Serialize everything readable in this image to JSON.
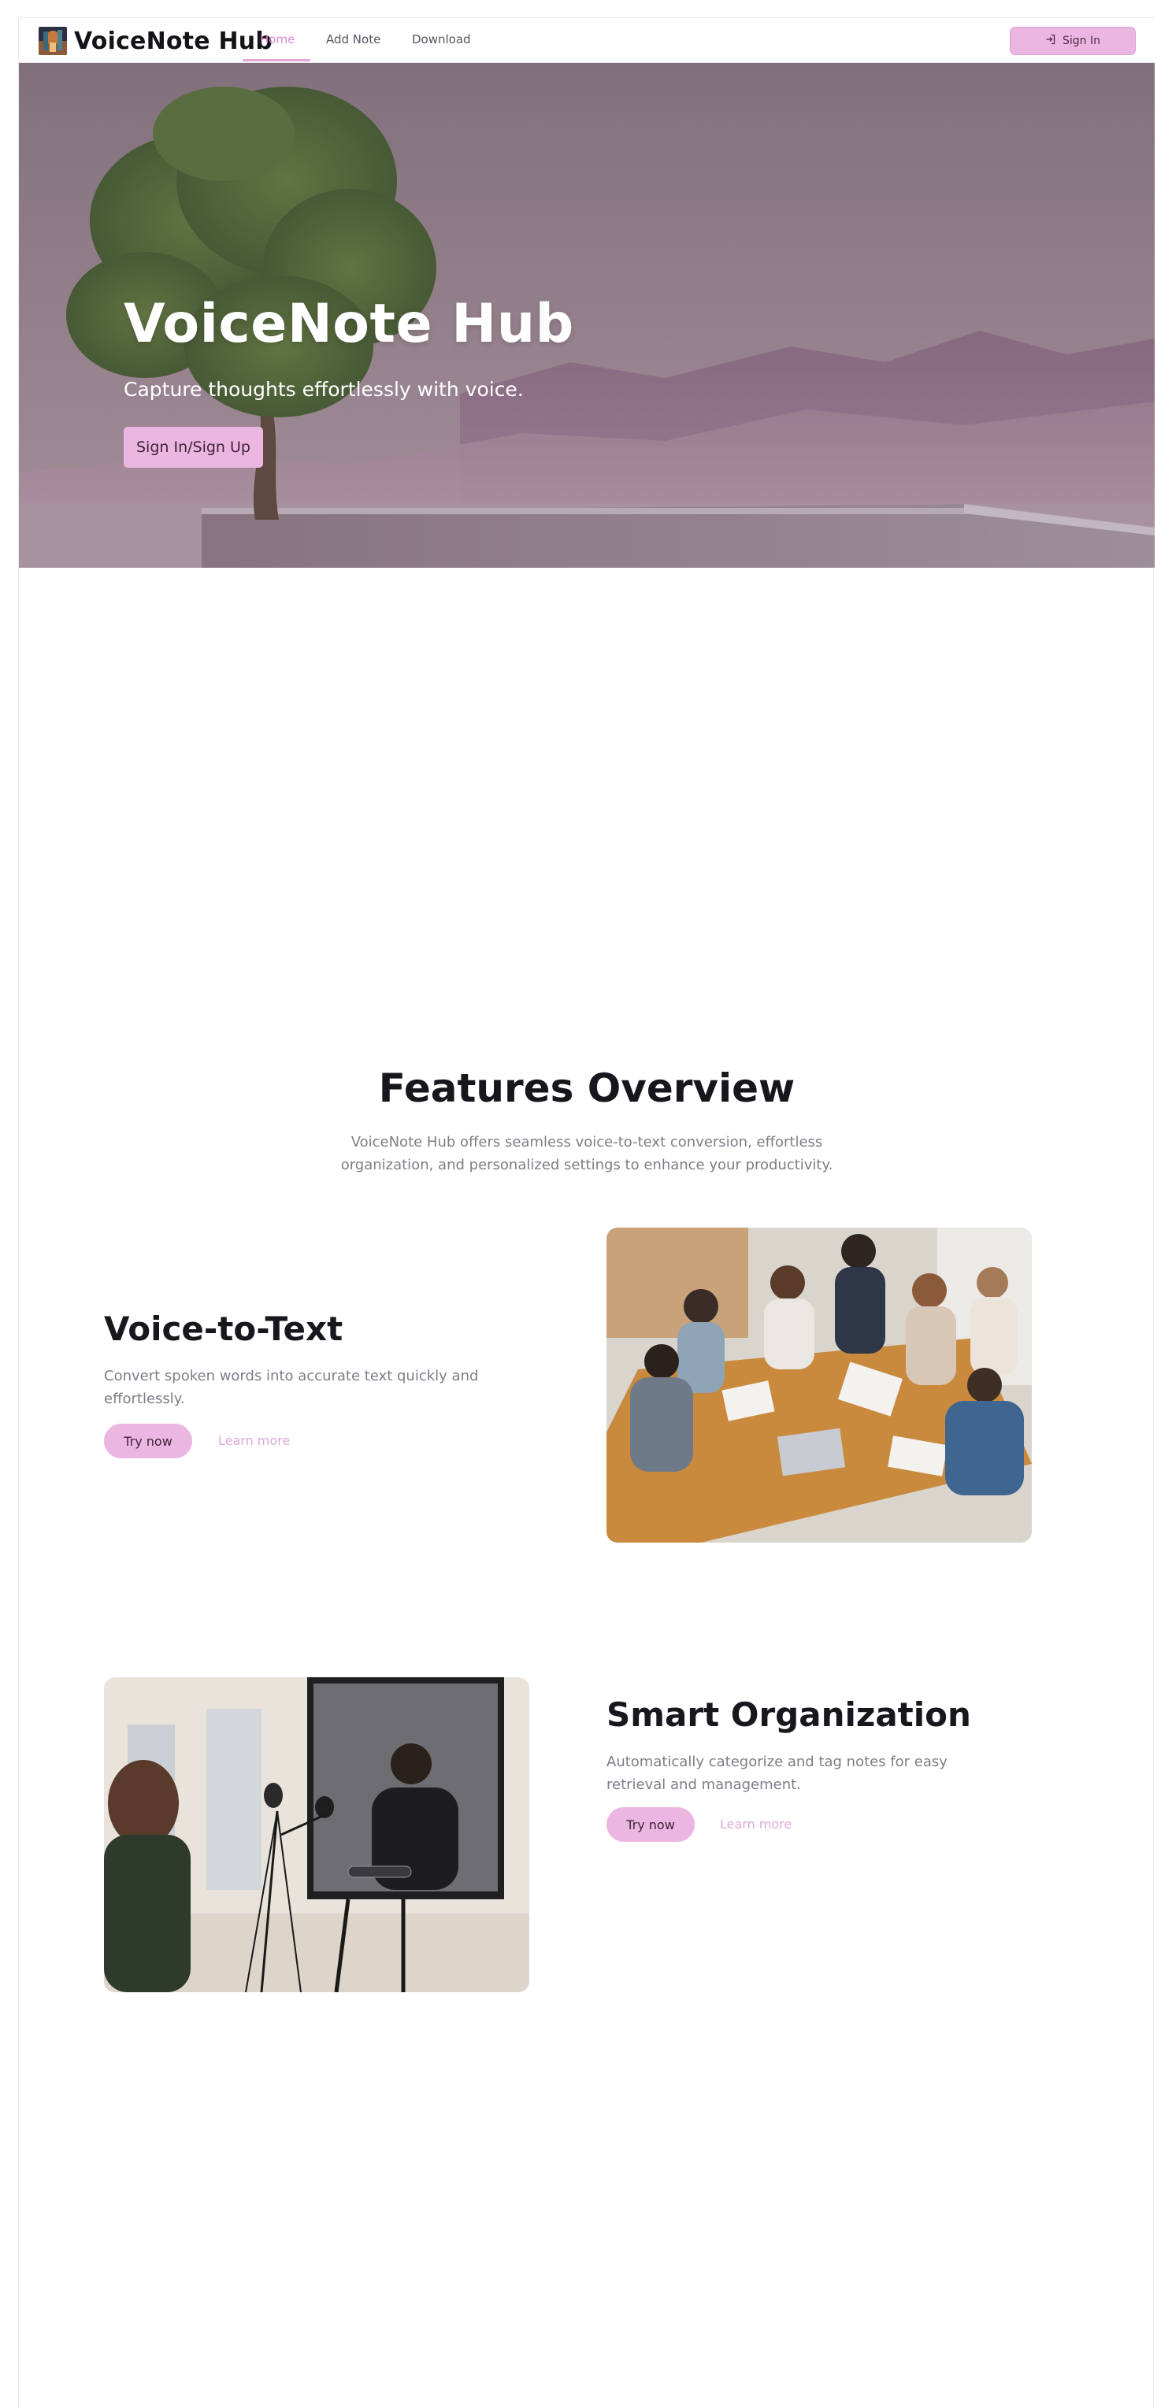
{
  "nav": {
    "brand": "VoiceNote Hub",
    "links": [
      {
        "label": "Home",
        "active": true
      },
      {
        "label": "Add Note",
        "active": false
      },
      {
        "label": "Download",
        "active": false
      }
    ],
    "signin_label": "Sign In"
  },
  "hero": {
    "title": "VoiceNote Hub",
    "subtitle": "Capture thoughts effortlessly with voice.",
    "cta_label": "Sign In/Sign Up"
  },
  "features": {
    "title": "Features Overview",
    "description": "VoiceNote Hub offers seamless voice-to-text conversion, effortless organization, and personalized settings to enhance your productivity.",
    "items": [
      {
        "title": "Voice-to-Text",
        "description": "Convert spoken words into accurate text quickly and effortlessly.",
        "try_label": "Try now",
        "learn_label": "Learn more"
      },
      {
        "title": "Smart Organization",
        "description": "Automatically categorize and tag notes for easy retrieval and management.",
        "try_label": "Try now",
        "learn_label": "Learn more"
      }
    ]
  },
  "colors": {
    "accent": "#ebb6e1",
    "accent_text": "#d98ccd",
    "heading": "#16161c",
    "muted": "#7d7d87"
  },
  "icons": {
    "signin": "sign-in-icon"
  }
}
